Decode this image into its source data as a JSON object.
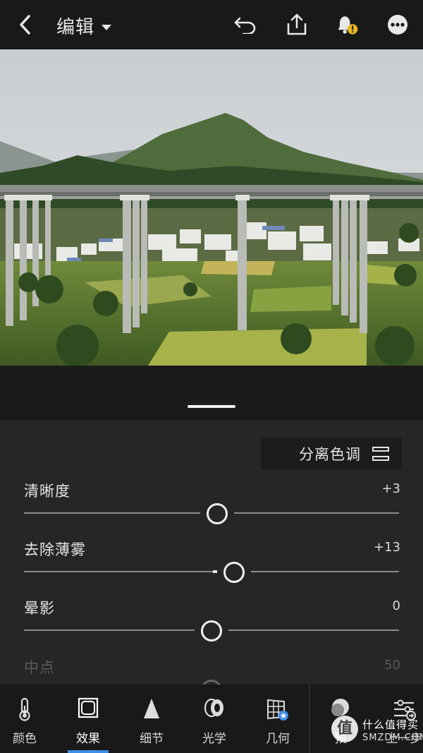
{
  "header": {
    "title": "编辑",
    "icons": [
      "back-icon",
      "undo-icon",
      "share-icon",
      "notification-alert-icon",
      "more-icon"
    ]
  },
  "panel": {
    "split_toning_label": "分离色调",
    "sliders": [
      {
        "label": "清晰度",
        "value_text": "+3",
        "level": 0.515
      },
      {
        "label": "去除薄雾",
        "value_text": "+13",
        "level": 0.56
      },
      {
        "label": "晕影",
        "value_text": "0",
        "level": 0.5
      },
      {
        "label": "中点",
        "value_text": "50",
        "level": 0.5
      }
    ]
  },
  "toolbar": {
    "tools": [
      {
        "label": "颜色",
        "icon": "thermometer-icon"
      },
      {
        "label": "效果",
        "icon": "effects-icon",
        "active": true
      },
      {
        "label": "细节",
        "icon": "detail-triangle-icon"
      },
      {
        "label": "光学",
        "icon": "lens-icon"
      },
      {
        "label": "几何",
        "icon": "geometry-icon"
      },
      {
        "label": "预",
        "icon": "presets-icon"
      },
      {
        "label": "上一步",
        "icon": "previous-settings-icon"
      }
    ]
  },
  "watermark": {
    "badge": "值",
    "line1": "什么值得买",
    "line2": "SMZDM.COM"
  },
  "colors": {
    "accent": "#3d8ee8",
    "background": "#202020",
    "panel": "#262626",
    "bar": "#191919"
  }
}
